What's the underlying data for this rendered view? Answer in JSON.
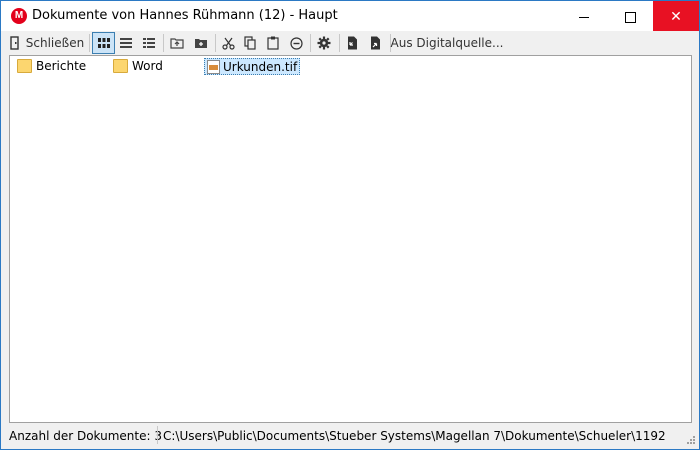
{
  "window": {
    "title": "Dokumente von Hannes Rühmann (12) - Haupt",
    "app_icon_letter": "M",
    "close_glyph": "✕"
  },
  "toolbar": {
    "close_label": "Schließen",
    "digital_source_label": "Aus Digitalquelle...",
    "icons": [
      "close-door-icon",
      "large-icons-view-icon",
      "list-view-icon",
      "details-view-icon",
      "folder-up-icon",
      "new-folder-icon",
      "cut-icon",
      "copy-icon",
      "paste-icon",
      "remove-icon",
      "settings-icon",
      "import-document-icon",
      "export-document-icon"
    ]
  },
  "files": [
    {
      "name": "Berichte",
      "type": "folder"
    },
    {
      "name": "Word",
      "type": "folder"
    },
    {
      "name": "Urkunden.tif",
      "type": "tif-file",
      "selected": true
    }
  ],
  "status": {
    "count_text": "Anzahl der Dokumente: 3",
    "path_text": "C:\\Users\\Public\\Documents\\Stueber Systems\\Magellan 7\\Dokumente\\Schueler\\1192"
  },
  "colors": {
    "accent_border": "#2b79c4",
    "close_button": "#e81123",
    "app_icon": "#e3001b",
    "selection": "#cce8ff"
  }
}
